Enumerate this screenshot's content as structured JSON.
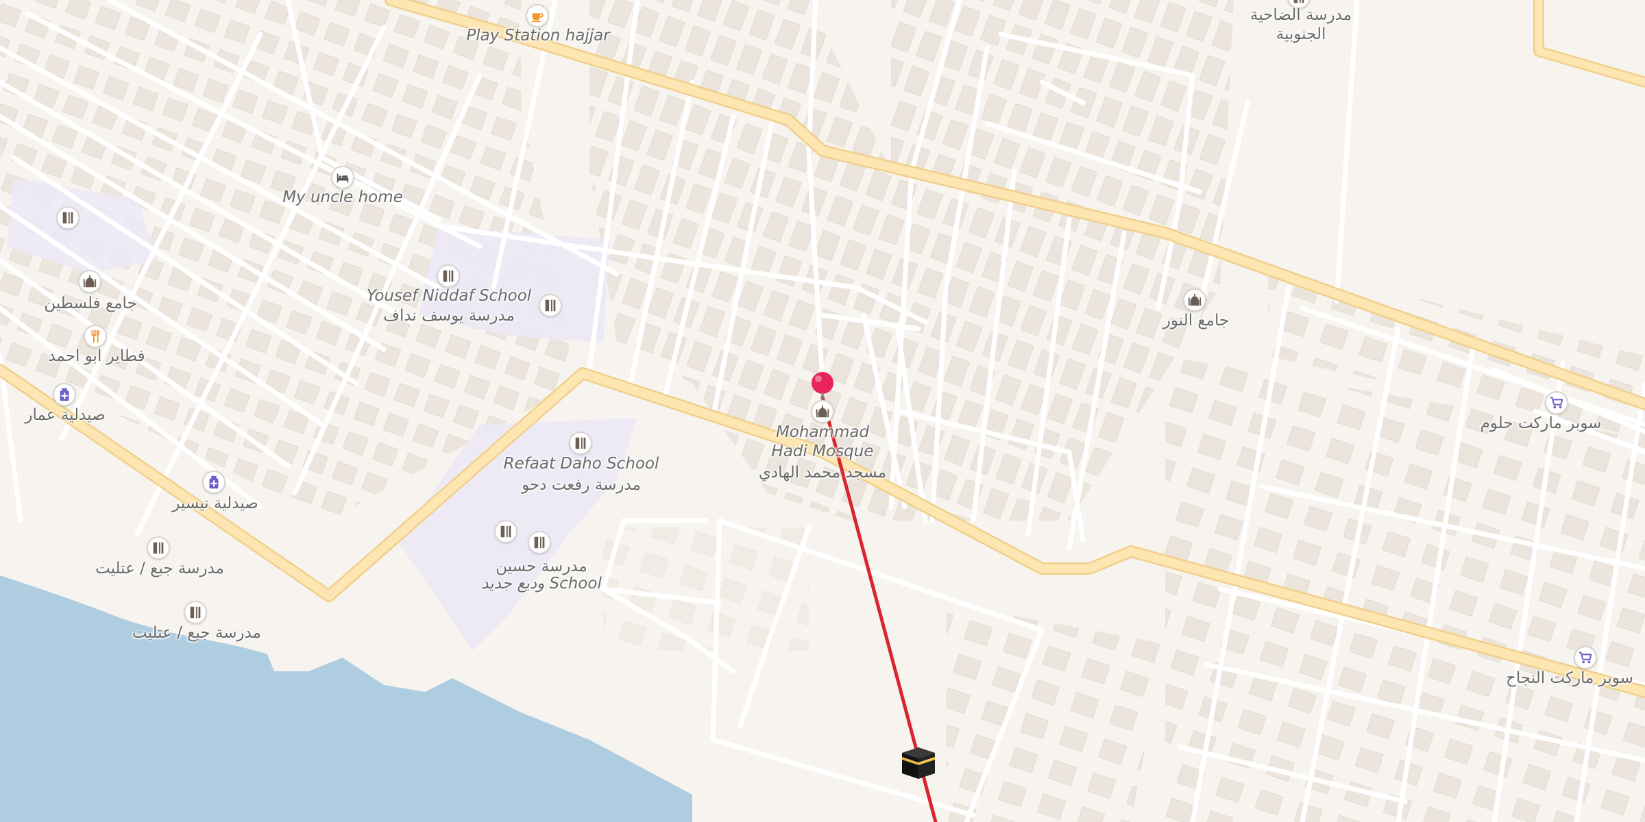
{
  "map": {
    "style": "street-map",
    "colors": {
      "land": "#f7f4ef",
      "building": "#ebe4dc",
      "minor_road": "#ffffff",
      "major_road": "#fde6b2",
      "major_road_casing": "#f0cf8a",
      "water": "#aecde1",
      "school_area": "#ece9f6",
      "qibla_line": "#d9262e",
      "marker": "#e8245a"
    },
    "markers": [
      {
        "name": "location-pin",
        "icon": "pin-icon"
      },
      {
        "name": "kaaba",
        "icon": "kaaba-icon"
      }
    ]
  },
  "pois": [
    {
      "id": "playstation",
      "icon": "cafe-icon",
      "label": "Play Station hajjar"
    },
    {
      "id": "south-school",
      "icon": "school-icon",
      "label": "مدرسة الضاحية الجنوبية"
    },
    {
      "id": "uncle-home",
      "icon": "lodging-icon",
      "label": "My uncle home"
    },
    {
      "id": "school-west",
      "icon": "school-icon",
      "label": ""
    },
    {
      "id": "palestine-mosque",
      "icon": "mosque-icon",
      "label": "جامع فلسطين"
    },
    {
      "id": "abu-ahmad",
      "icon": "restaurant-icon",
      "label": "فطاير ابو احمد"
    },
    {
      "id": "ammar-pharmacy",
      "icon": "pharmacy-icon",
      "label": "صيدلية عمار"
    },
    {
      "id": "yousef-niddaf",
      "icon": "school-icon",
      "label": "Yousef Niddaf School",
      "label_ar": "مدرسة يوسف نداف"
    },
    {
      "id": "school-yousef-2",
      "icon": "school-icon",
      "label": ""
    },
    {
      "id": "refaat-daho",
      "icon": "school-icon",
      "label": "Refaat Daho School",
      "label_ar": "مدرسة رفعت دحو"
    },
    {
      "id": "taiseer-pharmacy",
      "icon": "pharmacy-icon",
      "label": "صيدلية تيسير"
    },
    {
      "id": "jabaa-school-1",
      "icon": "school-icon",
      "label": "مدرسة جبع / عتليت"
    },
    {
      "id": "jabaa-school-2",
      "icon": "school-icon",
      "label": "مدرسة جبع / عتليت"
    },
    {
      "id": "hussein-school",
      "icon": "school-icon",
      "label": "مدرسة حسين",
      "label2": "وديع جديد School"
    },
    {
      "id": "hussein-school-2",
      "icon": "school-icon",
      "label": ""
    },
    {
      "id": "mohammad-hadi",
      "icon": "mosque-icon",
      "label": "Mohammad",
      "label2": "Hadi Mosque",
      "label_ar": "مسجد محمد الهادي"
    },
    {
      "id": "noor-mosque",
      "icon": "mosque-icon",
      "label": "جامع النور"
    },
    {
      "id": "halloum-market",
      "icon": "shop-icon",
      "label": "سوبر ماركت حلوم"
    },
    {
      "id": "najah-market",
      "icon": "shop-icon",
      "label": "سوبر ماركت النجاح"
    }
  ]
}
